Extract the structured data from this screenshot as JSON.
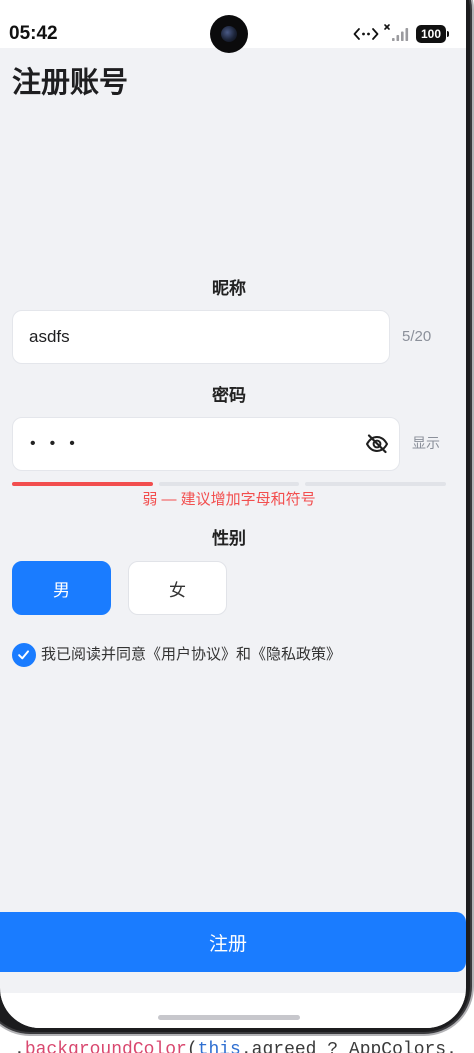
{
  "status_bar": {
    "time": "05:42",
    "battery": "100",
    "icons": [
      "data-transfer-icon",
      "signal-no-sim-icon",
      "battery-icon",
      "front-camera"
    ]
  },
  "page": {
    "title": "注册账号"
  },
  "form": {
    "nickname": {
      "label": "昵称",
      "value": "asdfs",
      "counter": "5/20"
    },
    "password": {
      "label": "密码",
      "masked_value": "•••",
      "visibility_icon": "eye-off-icon",
      "toggle_label": "显示",
      "strength": {
        "level": 1,
        "max_level": 3,
        "hint": "弱 — 建议增加字母和符号"
      }
    },
    "gender": {
      "label": "性别",
      "options": [
        {
          "label": "男",
          "selected": true
        },
        {
          "label": "女",
          "selected": false
        }
      ]
    },
    "agreement": {
      "checked": true,
      "check_icon": "check-icon",
      "parts": [
        "我已阅读并同意",
        "《用户协议》",
        "和",
        "《隐私政策》"
      ]
    },
    "submit_label": "注册"
  },
  "code_overlay": {
    "parts": [
      ".",
      "backgroundColor",
      "(",
      "this",
      ".agreed ? AppColors."
    ]
  },
  "colors": {
    "primary": "#1a7cff",
    "danger": "#f24e4e",
    "track": "#e1e3e8",
    "background": "#f1f2f5",
    "surface": "#ffffff"
  }
}
